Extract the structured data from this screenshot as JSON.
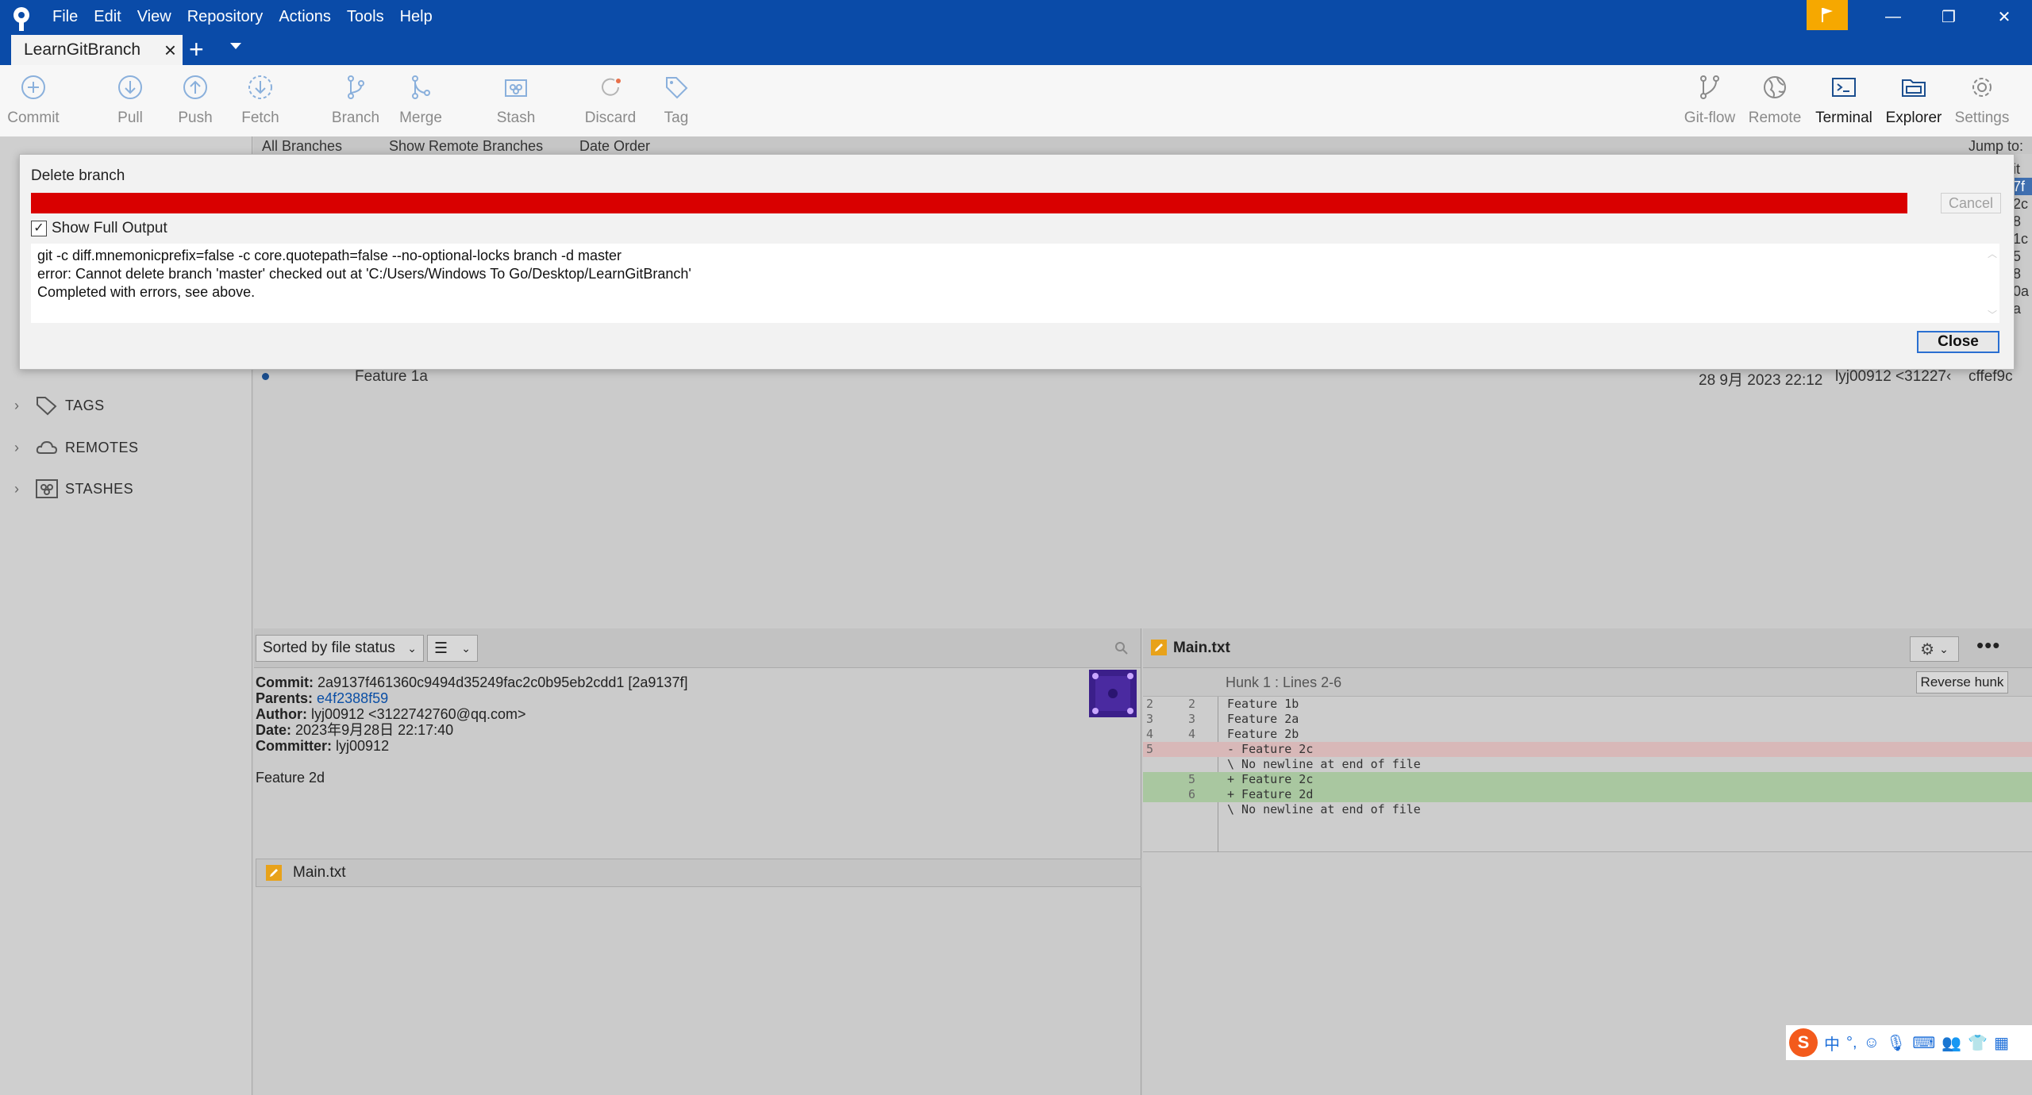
{
  "menu": [
    "File",
    "Edit",
    "View",
    "Repository",
    "Actions",
    "Tools",
    "Help"
  ],
  "tab": {
    "title": "LearnGitBranch"
  },
  "toolbar_left": [
    "Commit",
    "Pull",
    "Push",
    "Fetch",
    "Branch",
    "Merge",
    "Stash",
    "Discard",
    "Tag"
  ],
  "toolbar_right": [
    "Git-flow",
    "Remote",
    "Terminal",
    "Explorer",
    "Settings"
  ],
  "filter": {
    "branches": "All Branches",
    "show_remote": "Show Remote Branches",
    "order": "Date Order",
    "jump": "Jump to:"
  },
  "right_edge_fragments": [
    "it",
    "7f",
    "2c",
    "8",
    "1c",
    "5",
    "8",
    "0a",
    "a"
  ],
  "sidebar": {
    "tags": "TAGS",
    "remotes": "REMOTES",
    "stashes": "STASHES"
  },
  "commit_row": {
    "message": "Feature 1a",
    "date": "28 9月 2023 22:12",
    "author": "lyj00912 <31227‹",
    "hash": "cffef9c"
  },
  "details": {
    "sort_label": "Sorted by file status",
    "commit_label": "Commit:",
    "commit": "2a9137f461360c9494d35249fac2c0b95eb2cdd1 [2a9137f]",
    "parents_label": "Parents:",
    "parents": "e4f2388f59",
    "author_label": "Author:",
    "author": "lyj00912 <3122742760@qq.com>",
    "date_label": "Date:",
    "date": "2023年9月28日 22:17:40",
    "committer_label": "Committer:",
    "committer": "lyj00912",
    "message": "Feature 2d",
    "file": "Main.txt"
  },
  "diff": {
    "file": "Main.txt",
    "hunk": "Hunk 1 : Lines 2-6",
    "reverse": "Reverse hunk",
    "lines": [
      {
        "old": "2",
        "new": "2",
        "text": "  Feature 1b",
        "type": "ctx"
      },
      {
        "old": "3",
        "new": "3",
        "text": "  Feature 2a",
        "type": "ctx"
      },
      {
        "old": "4",
        "new": "4",
        "text": "  Feature 2b",
        "type": "ctx"
      },
      {
        "old": "5",
        "new": "",
        "text": "- Feature 2c",
        "type": "del"
      },
      {
        "old": "",
        "new": "",
        "text": "\\  No newline at end of file",
        "type": "ctx"
      },
      {
        "old": "",
        "new": "5",
        "text": "+ Feature 2c",
        "type": "add"
      },
      {
        "old": "",
        "new": "6",
        "text": "+ Feature 2d",
        "type": "add"
      },
      {
        "old": "",
        "new": "",
        "text": "\\  No newline at end of file",
        "type": "ctx"
      }
    ]
  },
  "dialog": {
    "title": "Delete branch",
    "cancel": "Cancel",
    "show_full_output": "Show Full Output",
    "output": [
      "git -c diff.mnemonicprefix=false -c core.quotepath=false --no-optional-locks branch -d master",
      "error: Cannot delete branch 'master' checked out at 'C:/Users/Windows To Go/Desktop/LearnGitBranch'",
      "Completed with errors, see above."
    ],
    "close": "Close",
    "progress_color": "#d90000"
  },
  "ime": {
    "lang": "中"
  }
}
